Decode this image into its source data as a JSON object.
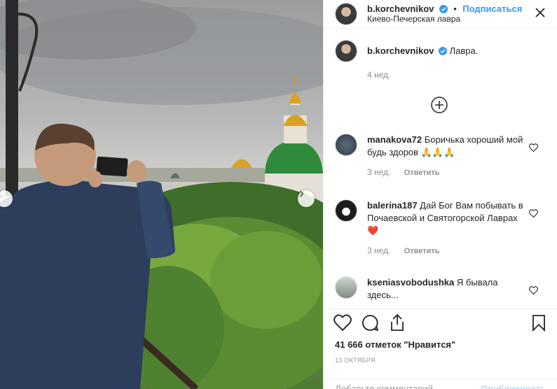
{
  "header": {
    "username": "b.korchevnikov",
    "separator": "•",
    "follow_label": "Подписаться",
    "location": "Киево-Печерская лавра"
  },
  "caption": {
    "username": "b.korchevnikov",
    "text": "Лавра.",
    "time": "4 нед."
  },
  "comments": [
    {
      "username": "manakova72",
      "text": "Боричька хороший мой будь здоров 🙏🙏🙏",
      "time": "3 нед.",
      "reply_label": "Ответить"
    },
    {
      "username": "balerina187",
      "text": "Дай Бог Вам побывать в Почаевской и Святогорской Лаврах❤️",
      "time": "3 нед.",
      "reply_label": "Ответить"
    },
    {
      "username": "ksenia­svobodushka",
      "text": "Я бывала здесь...",
      "time": "",
      "reply_label": ""
    }
  ],
  "likes": "41 666 отметок \"Нравится\"",
  "date": "13 ОКТЯБРЯ",
  "add_comment": {
    "placeholder": "Добавьте комментарий...",
    "post_label": "Опубликовать"
  },
  "colors": {
    "accent": "#3897f0",
    "verified": "#3897f0",
    "muted": "#8e8e8e"
  },
  "icons": [
    "more-icon",
    "verified-icon",
    "plus-circle-icon",
    "heart-icon",
    "comment-icon",
    "share-icon",
    "bookmark-icon",
    "chevron-left-icon",
    "chevron-right-icon"
  ]
}
